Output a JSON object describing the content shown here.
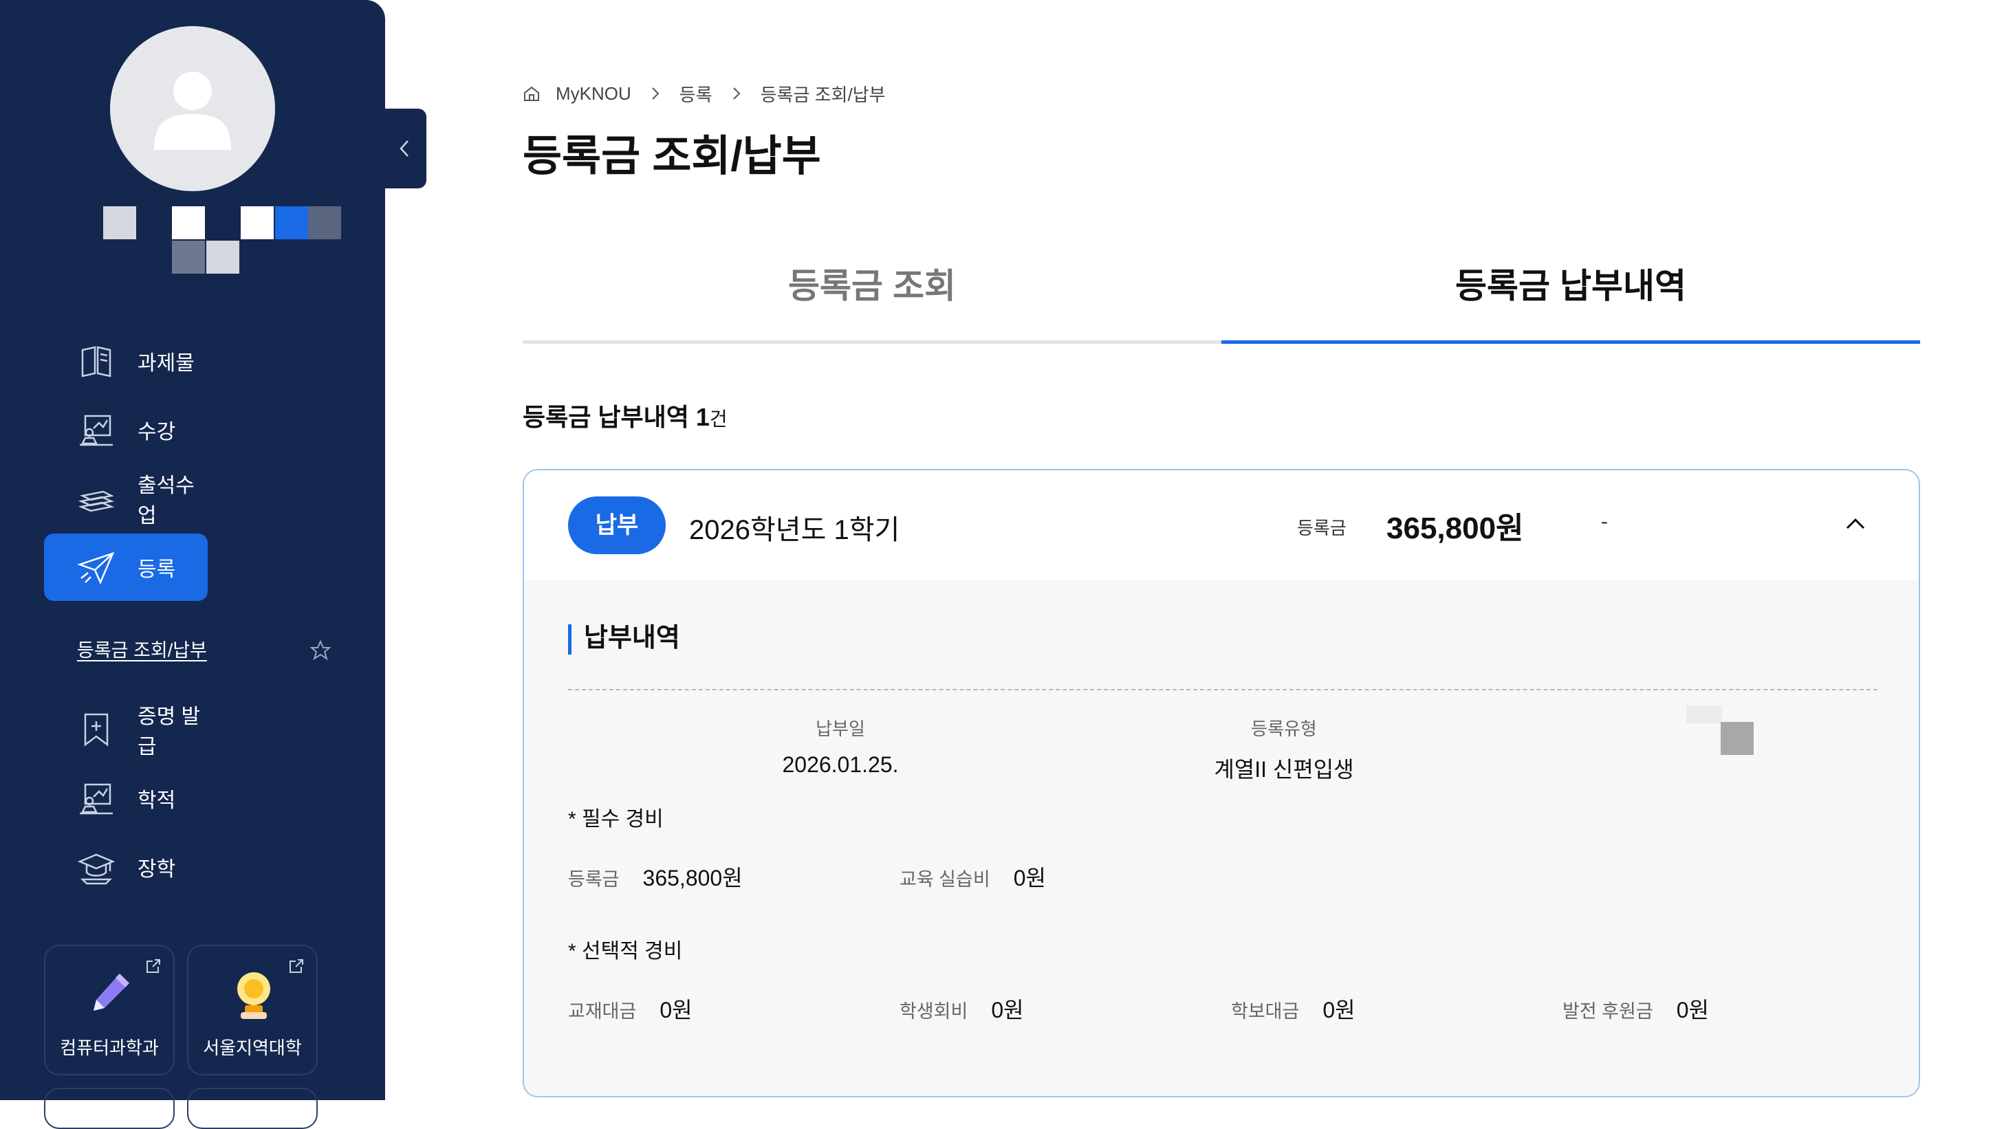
{
  "colors": {
    "sidebar_bg": "#14274e",
    "accent": "#1a6ae6",
    "panel_border": "#9fc4ee"
  },
  "sidebar": {
    "nav": [
      {
        "label": "과제물",
        "icon": "open-book-icon"
      },
      {
        "label": "수강",
        "icon": "lecture-icon"
      },
      {
        "label": "출석수업",
        "icon": "books-stack-icon"
      },
      {
        "label": "등록",
        "icon": "paper-plane-icon",
        "active": true
      },
      {
        "label": "증명 발급",
        "icon": "bookmark-plus-icon"
      },
      {
        "label": "학적",
        "icon": "lecture-icon"
      },
      {
        "label": "장학",
        "icon": "graduation-cap-icon"
      }
    ],
    "sub_item": {
      "label": "등록금 조회/납부",
      "icon": "star-icon"
    },
    "quick_links": [
      {
        "label": "컴퓨터과학과",
        "icon": "pencil-icon"
      },
      {
        "label": "서울지역대학",
        "icon": "lightbulb-icon"
      }
    ]
  },
  "breadcrumb": {
    "items": [
      "MyKNOU",
      "등록",
      "등록금 조회/납부"
    ]
  },
  "page": {
    "title": "등록금 조회/납부"
  },
  "tabs": [
    {
      "label": "등록금 조회"
    },
    {
      "label": "등록금 납부내역",
      "active": true
    }
  ],
  "summary": {
    "label": "등록금 납부내역 1",
    "unit": "건"
  },
  "record": {
    "badge": "납부",
    "term": "2026학년도 1학기",
    "fee_label": "등록금",
    "fee_value": "365,800원",
    "dash": "-",
    "section_title": "납부내역",
    "paid_date_label": "납부일",
    "paid_date": "2026.01.25.",
    "reg_type_label": "등록유형",
    "reg_type": "계열II 신편입생",
    "required_title": "* 필수 경비",
    "required": [
      {
        "label": "등록금",
        "value": "365,800원"
      },
      {
        "label": "교육 실습비",
        "value": "0원"
      }
    ],
    "optional_title": "* 선택적 경비",
    "optional": [
      {
        "label": "교재대금",
        "value": "0원"
      },
      {
        "label": "학생회비",
        "value": "0원"
      },
      {
        "label": "학보대금",
        "value": "0원"
      },
      {
        "label": "발전 후원금",
        "value": "0원"
      }
    ]
  }
}
